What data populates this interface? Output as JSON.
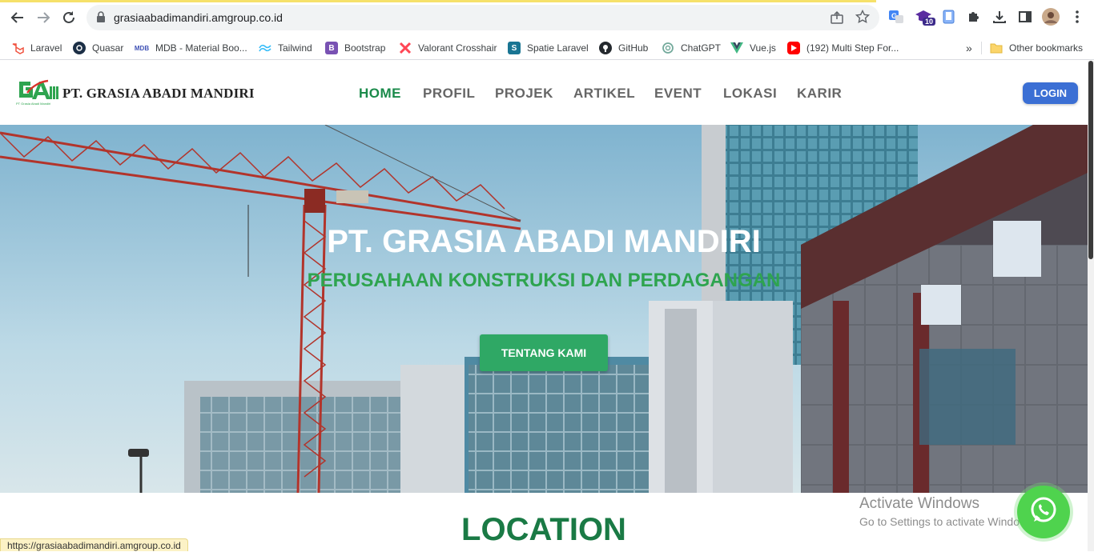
{
  "browser": {
    "url": "grasiaabadimandiri.amgroup.co.id",
    "extension_badge": "10",
    "bookmarks": [
      {
        "label": "Laravel",
        "icon": "laravel-icon",
        "color": "#f05340"
      },
      {
        "label": "Quasar",
        "icon": "quasar-icon",
        "color": "#1976d2"
      },
      {
        "label": "MDB - Material Boo...",
        "icon": "mdb-icon",
        "color": "#3f51b5"
      },
      {
        "label": "Tailwind",
        "icon": "tailwind-icon",
        "color": "#38bdf8"
      },
      {
        "label": "Bootstrap",
        "icon": "bootstrap-icon",
        "color": "#7952b3"
      },
      {
        "label": "Valorant Crosshair",
        "icon": "valorant-icon",
        "color": "#ff4655"
      },
      {
        "label": "Spatie Laravel",
        "icon": "spatie-icon",
        "color": "#197593"
      },
      {
        "label": "GitHub",
        "icon": "github-icon",
        "color": "#24292e"
      },
      {
        "label": "ChatGPT",
        "icon": "chatgpt-icon",
        "color": "#74aa9c"
      },
      {
        "label": "Vue.js",
        "icon": "vue-icon",
        "color": "#41b883"
      },
      {
        "label": "(192) Multi Step For...",
        "icon": "youtube-icon",
        "color": "#ff0000"
      }
    ],
    "more_bookmarks": "»",
    "other_bookmarks": "Other bookmarks",
    "status_url": "https://grasiaabadimandiri.amgroup.co.id"
  },
  "site": {
    "brand": "PT. GRASIA ABADI MANDIRI",
    "logo_text": "PT Grasia Abadi Mandiri",
    "menu": [
      {
        "label": "HOME",
        "active": true
      },
      {
        "label": "PROFIL",
        "active": false
      },
      {
        "label": "PROJEK",
        "active": false
      },
      {
        "label": "ARTIKEL",
        "active": false
      },
      {
        "label": "EVENT",
        "active": false
      },
      {
        "label": "LOKASI",
        "active": false
      },
      {
        "label": "KARIR",
        "active": false
      }
    ],
    "login": "LOGIN",
    "colors": {
      "accent": "#1a8a4a",
      "login": "#3b6fd4",
      "cta": "#2fa865"
    }
  },
  "hero": {
    "title": "PT. GRASIA ABADI MANDIRI",
    "subtitle": "PERUSAHAAN KONSTRUKSI DAN PERDAGANGAN",
    "cta": "TENTANG KAMI"
  },
  "location": {
    "title": "LOCATION"
  },
  "windows": {
    "line1": "Activate Windows",
    "line2": "Go to Settings to activate Windows."
  }
}
